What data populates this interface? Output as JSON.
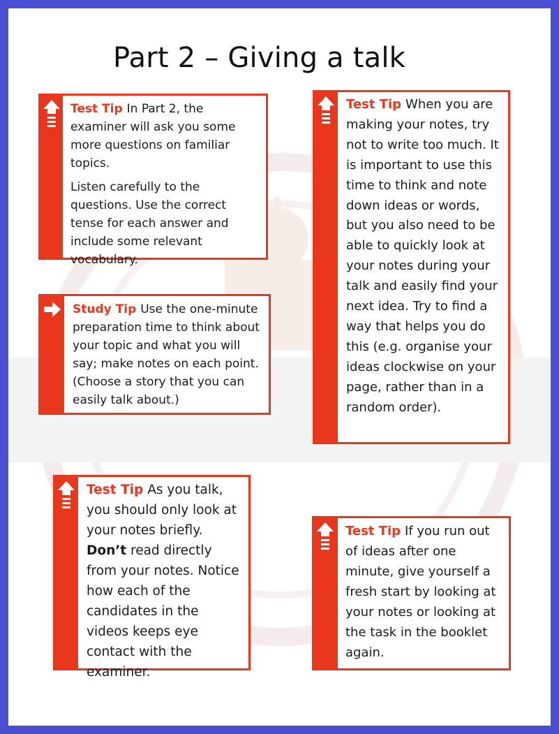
{
  "page": {
    "title": "Part 2 – Giving a talk"
  },
  "colors": {
    "accent": "#e8371d",
    "frame": "#4a4fd1",
    "text": "#1b1b1b"
  },
  "tips": [
    {
      "icon": "up-arrow-icon",
      "heading": "Test Tip",
      "paragraphs": [
        "In Part 2, the examiner will ask you some more questions on familiar topics.",
        "Listen carefully to the questions. Use the correct tense for each answer and include some relevant vocabulary."
      ]
    },
    {
      "icon": "right-arrow-icon",
      "heading": "Study Tip",
      "paragraphs": [
        "Use the one-minute preparation time to think about your topic and what you will say; make notes on each point. (Choose a story that you can easily talk about.)"
      ]
    },
    {
      "icon": "up-arrow-icon",
      "heading": "Test Tip",
      "paragraphs": [
        "When you are making your notes, try not to write too much. It is important to use this time to think and note down ideas or words, but you also need to be able to quickly look at your notes during your talk and easily find your next idea. Try to find a way that helps you do this (e.g. organise your ideas clockwise on your page, rather than in a random order)."
      ]
    },
    {
      "icon": "up-arrow-icon",
      "heading": "Test Tip",
      "text_before": "As you talk, you should only look at your notes briefly.",
      "emphasis": "Don’t",
      "text_after": "read directly from your notes. Notice how each of the candidates in the videos keeps eye contact with the examiner."
    },
    {
      "icon": "up-arrow-icon",
      "heading": "Test Tip",
      "paragraphs": [
        "If you run out of ideas after one minute, give yourself a fresh start by looking at your notes or looking at the task in the booklet again."
      ]
    }
  ]
}
